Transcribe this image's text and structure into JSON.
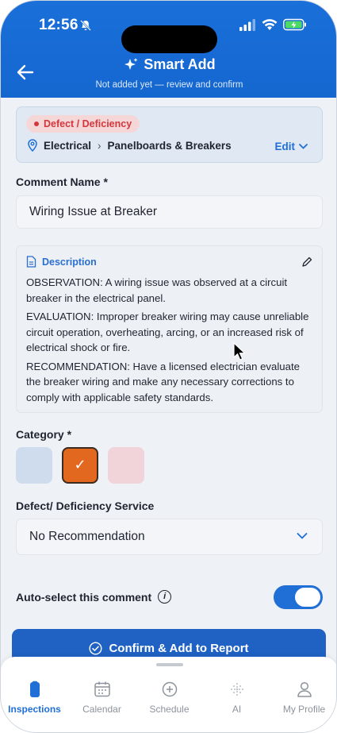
{
  "status_bar": {
    "time": "12:56"
  },
  "header": {
    "title": "Smart Add",
    "subtitle": "Not added yet — review and confirm"
  },
  "type_card": {
    "badge": "Defect / Deficiency",
    "crumb_parent": "Electrical",
    "crumb_child": "Panelboards & Breakers",
    "edit_label": "Edit"
  },
  "comment_name": {
    "label": "Comment Name *",
    "value": "Wiring Issue at Breaker"
  },
  "description": {
    "label": "Description",
    "observation": "OBSERVATION: A wiring issue was observed at a circuit breaker in the electrical panel.",
    "evaluation": "EVALUATION: Improper breaker wiring may cause unreliable circuit operation, overheating, arcing, or an increased risk of electrical shock or fire.",
    "recommendation": "RECOMMENDATION: Have a licensed electrician evaluate the breaker wiring and make any necessary corrections to comply with applicable safety standards."
  },
  "category": {
    "label": "Category *",
    "swatches": [
      "#cfdcee",
      "#e3681f",
      "#f1d4d9"
    ],
    "selected_mark": "✓"
  },
  "service": {
    "label": "Defect/ Deficiency Service",
    "value": "No Recommendation"
  },
  "auto_select": {
    "label": "Auto-select this comment",
    "info_glyph": "i",
    "enabled": true
  },
  "confirm_button": "Confirm & Add to Report",
  "tabs": [
    {
      "label": "Inspections",
      "icon": "inspections-icon",
      "active": true
    },
    {
      "label": "Calendar",
      "icon": "calendar-icon",
      "active": false
    },
    {
      "label": "Schedule",
      "icon": "schedule-plus-icon",
      "active": false
    },
    {
      "label": "AI",
      "icon": "ai-sparkle-icon",
      "active": false
    },
    {
      "label": "My Profile",
      "icon": "profile-icon",
      "active": false
    }
  ],
  "colors": {
    "primary": "#1f6fd6",
    "header": "#1a6fd8",
    "badge_red": "#d3363c",
    "category_orange": "#e3681f"
  }
}
